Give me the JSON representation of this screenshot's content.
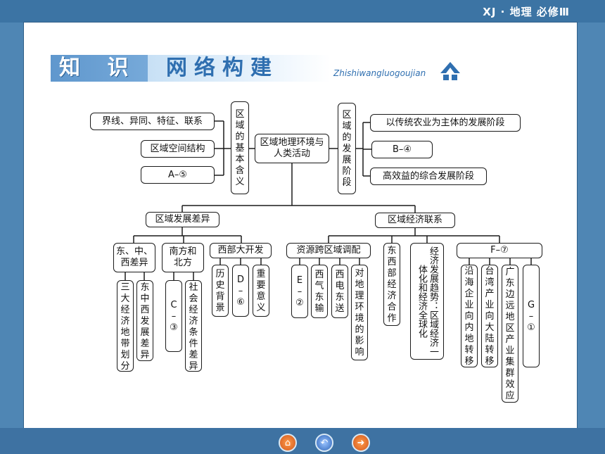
{
  "brand": "XJ · 地理  必修Ⅲ",
  "header": {
    "zhi_shi": "知 识",
    "title": "网络构建",
    "pinyin": "Zhishiwangluogoujian"
  },
  "nodes": {
    "center": "区域地理环境与人类活动",
    "left_col": "区域的基本含义",
    "left_items": [
      "界线、异同、特征、联系",
      "区域空间结构",
      "A–⑤"
    ],
    "right_col": "区域的发展阶段",
    "right_items": [
      "以传统农业为主体的发展阶段",
      "B–④",
      "高效益的综合发展阶段"
    ],
    "diff": "区域发展差异",
    "econ": "区域经济联系",
    "diff_groups": {
      "east_mid_west": "东、中、西差异",
      "south_north": "南方和北方",
      "west_dev": "西部大开发"
    },
    "diff_leaves": {
      "three_belts": "三大经济地带划分",
      "emw_diff": "东中西发展差异",
      "c3": "C–③",
      "socio": "社会经济条件差异",
      "history": "历史背景",
      "d6": "D–⑥",
      "meaning": "重要意义"
    },
    "econ_groups": {
      "resource": "资源跨区域调配",
      "cooperation": "东西部经济合作",
      "globalization": "经济发展趋势：区域经济一体化和经济全球化",
      "f7": "F–⑦"
    },
    "econ_leaves": {
      "e2": "E–②",
      "gas": "西气东输",
      "power": "西电东送",
      "impact": "对地理环境的影响",
      "coastal": "沿海企业向内地转移",
      "taiwan": "台湾产业向大陆转移",
      "guangdong": "广东边远地区产业集群效应",
      "g1": "G–①"
    }
  },
  "colors": {
    "frame_bg": "#4f86b4",
    "slide_bg": "#ffffff",
    "header_blue": "#2f6fb0"
  },
  "nav_icons": [
    "home-icon",
    "back-icon",
    "forward-icon"
  ]
}
